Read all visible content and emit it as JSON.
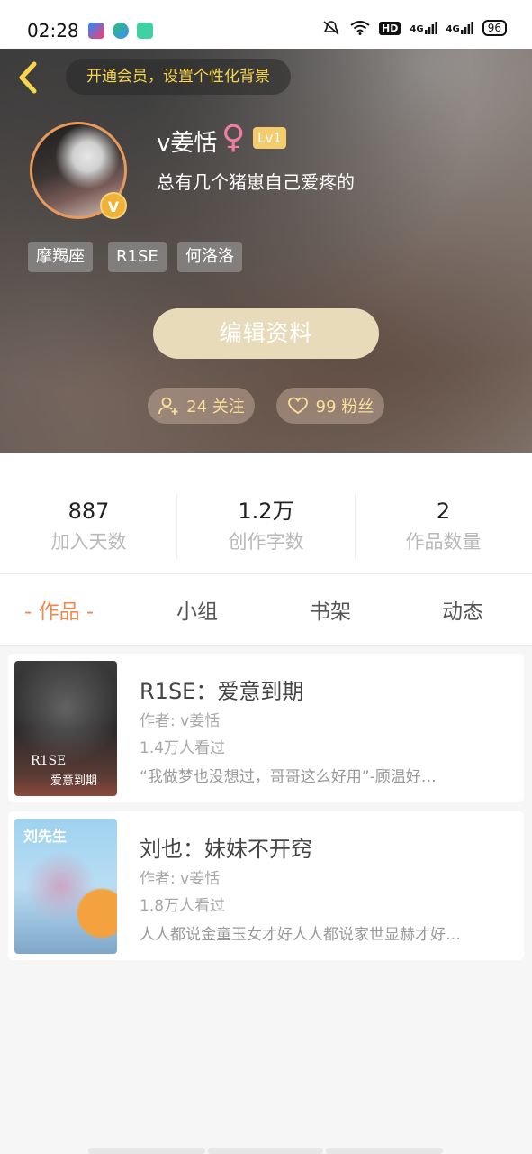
{
  "status_bar": {
    "time": "02:28",
    "hd_label": "HD",
    "net1": "4G",
    "net2": "4G",
    "battery": "96"
  },
  "header": {
    "vip_prompt": "开通会员，设置个性化背景",
    "username": "v姜恬",
    "gender_symbol": "♀",
    "level": "Lv1",
    "verified_badge": "V",
    "bio": "总有几个猪崽自己爱疼的",
    "tags": [
      "摩羯座",
      "R1SE",
      "何洛洛"
    ],
    "edit_button": "编辑资料",
    "following": "24 关注",
    "followers": "99 粉丝"
  },
  "stats": [
    {
      "value": "887",
      "label": "加入天数"
    },
    {
      "value": "1.2万",
      "label": "创作字数"
    },
    {
      "value": "2",
      "label": "作品数量"
    }
  ],
  "tabs": [
    "- 作品 -",
    "小组",
    "书架",
    "动态"
  ],
  "works": [
    {
      "title": "R1SE：爱意到期",
      "author": "作者: v姜恬",
      "views": "1.4万人看过",
      "desc": "“我做梦也没想过，哥哥这么好用”-顾温好…",
      "cover_text": "R1SE",
      "cover_sub": "爱意到期"
    },
    {
      "title": "刘也：妹妹不开窍",
      "author": "作者: v姜恬",
      "views": "1.8万人看过",
      "desc": "人人都说金童玉女才好人人都说家世显赫才好…",
      "cover_text": "刘先生"
    }
  ],
  "colors": {
    "accent": "#ee8a4b",
    "vip_text": "#f6d64b",
    "edit_button": "#e8dbb9",
    "level_badge": "#f4cc6b",
    "female": "#f07da6"
  }
}
